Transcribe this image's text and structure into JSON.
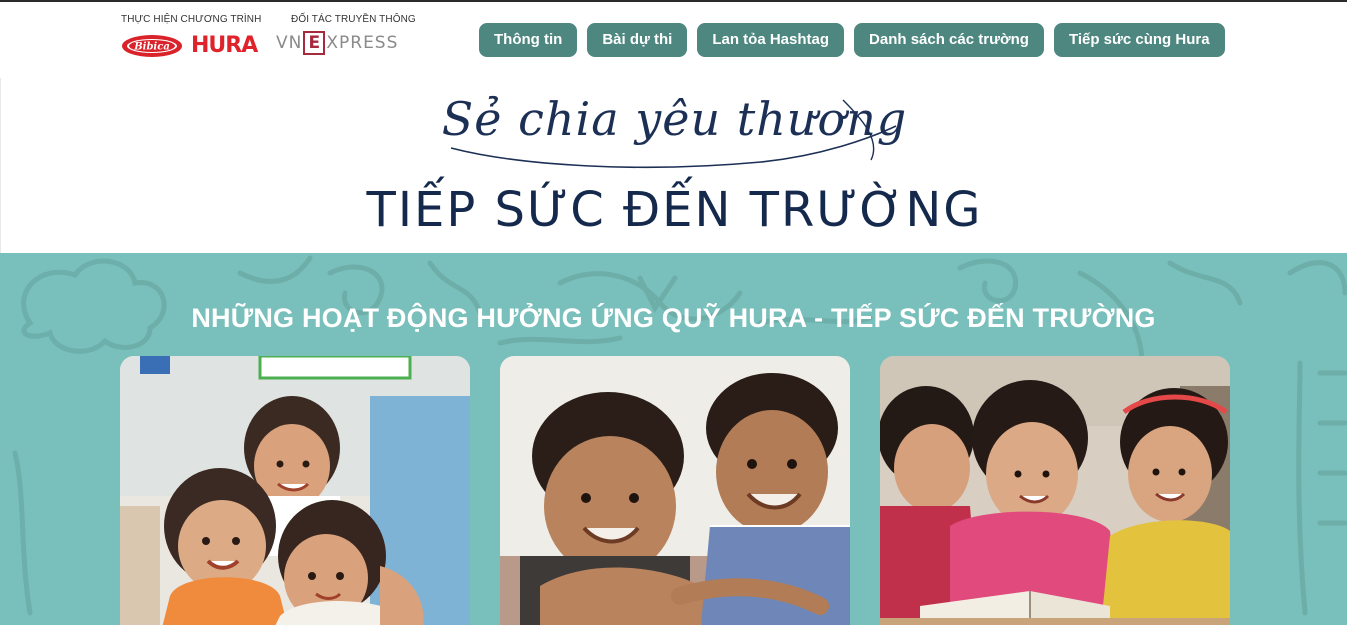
{
  "header": {
    "sponsor_caption": "THỰC HIỆN CHƯƠNG TRÌNH",
    "sponsor_logo_bibica": "Bibica",
    "sponsor_logo_hura": "HURA",
    "partner_caption": "ĐỐI TÁC TRUYỀN THÔNG",
    "partner_logo_left": "VN",
    "partner_logo_box": "E",
    "partner_logo_right": "XPRESS"
  },
  "nav": {
    "items": [
      {
        "label": "Thông tin"
      },
      {
        "label": "Bài dự thi"
      },
      {
        "label": "Lan tỏa Hashtag"
      },
      {
        "label": "Danh sách các trường"
      },
      {
        "label": "Tiếp sức cùng Hura"
      }
    ]
  },
  "hero": {
    "script_line": "Sẻ chia yêu thương",
    "title": "TIẾP SỨC ĐẾN TRƯỜNG"
  },
  "activities": {
    "title": "NHỮNG HOẠT ĐỘNG HƯỞNG ỨNG QUỸ HURA - TIẾP SỨC ĐẾN TRƯỜNG",
    "cards": [
      {
        "image": "children-hugging-photo"
      },
      {
        "image": "two-boys-smiling-photo"
      },
      {
        "image": "girls-reading-book-photo"
      }
    ]
  },
  "colors": {
    "nav_button": "#4d8780",
    "section_bg": "#79bfbb",
    "hero_text": "#15294d",
    "hura_red": "#e0232b"
  }
}
